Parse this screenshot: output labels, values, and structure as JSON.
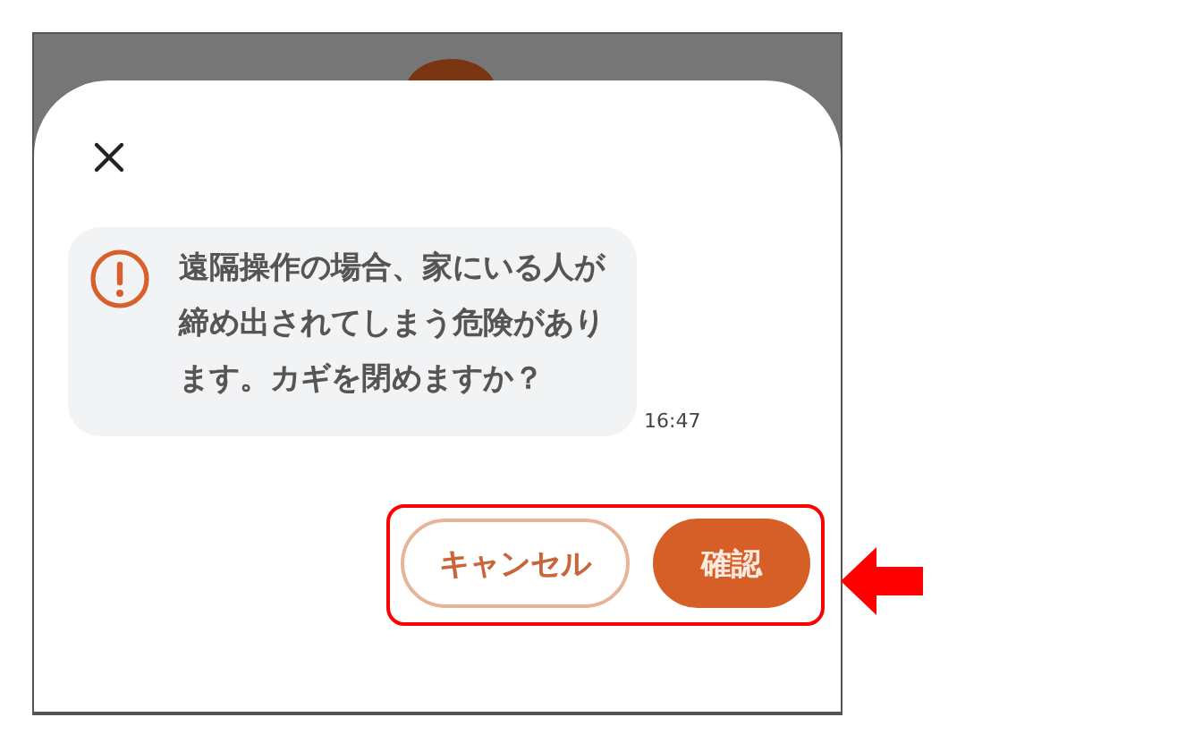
{
  "dialog": {
    "message": {
      "text": "遠隔操作の場合、家にいる人が締め出されてしまう危険があります。カギを閉めますか？",
      "time": "16:47"
    },
    "buttons": [
      {
        "label": "キャンセル",
        "kind": "outline"
      },
      {
        "label": "確認",
        "kind": "filled"
      }
    ]
  }
}
